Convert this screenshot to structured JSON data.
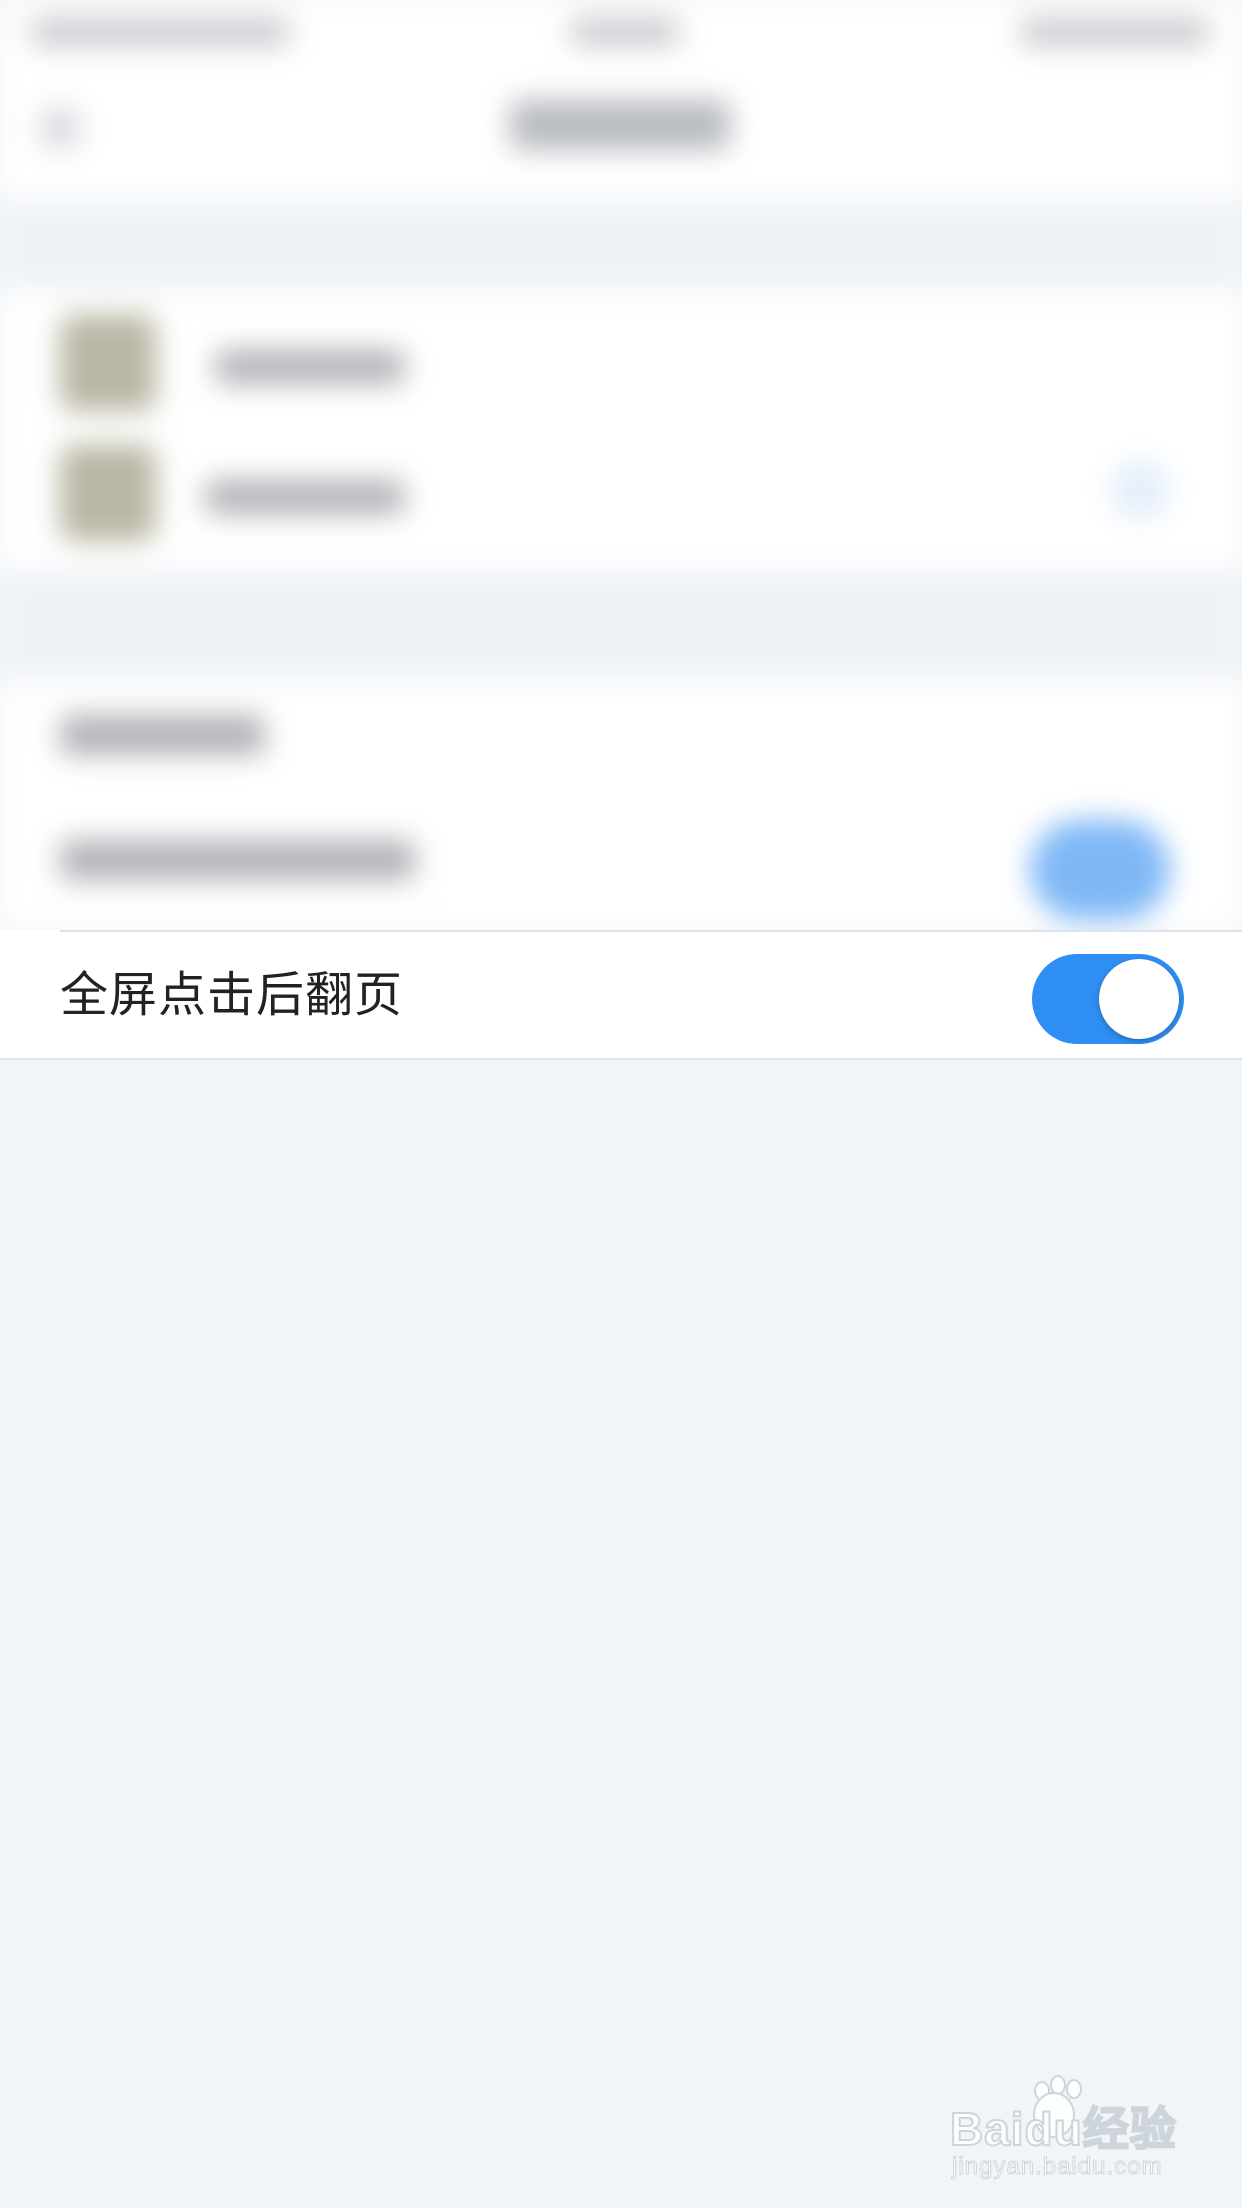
{
  "settings": {
    "page_turn_label": "全屏点击后翻页",
    "page_turn_enabled": true
  },
  "watermark": {
    "brand": "Baidu经验",
    "url": "jingyan.baidu.com"
  },
  "colors": {
    "accent": "#2f8ef3",
    "page_background": "#f1f5f8",
    "row_background": "#ffffff",
    "label_text": "#222222"
  }
}
